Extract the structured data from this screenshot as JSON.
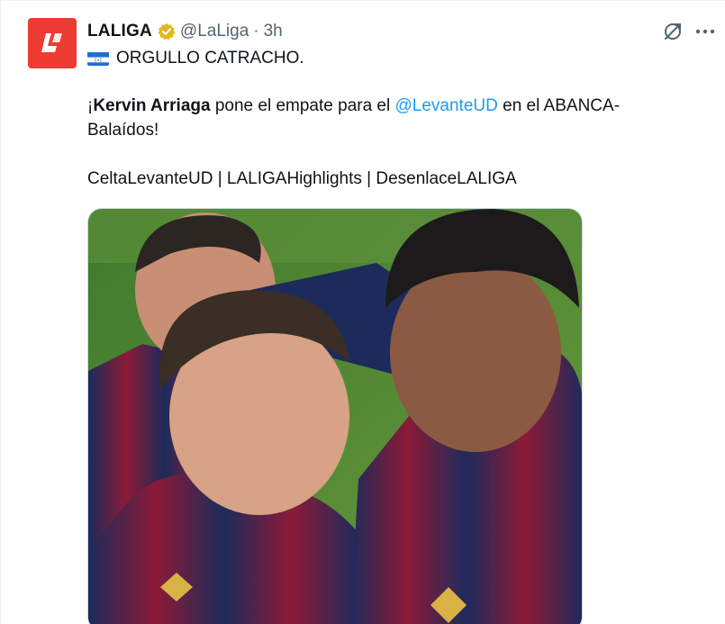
{
  "tweet": {
    "author_name": "LALIGA",
    "handle": "@LaLiga",
    "separator": "·",
    "time": "3h",
    "flag_icon": "honduras-flag-icon",
    "line1": "ORGULLO CATRACHO.",
    "line2_start": "¡",
    "line2_bold": "Kervin Arriaga",
    "line2_mid": " pone el empate para el ",
    "line2_mention": "@LevanteUD",
    "line2_end": " en el ABANCA-",
    "line3": "Balaídos!",
    "hashtags": "CeltaLevanteUD | LALIGAHighlights | DesenlaceLALIGA",
    "media_alt": "Levante players celebrating"
  },
  "colors": {
    "brand_red": "#ee3b33",
    "verified_gold": "#e2b719",
    "mention_blue": "#1d9bf0",
    "secondary_text": "#536471"
  },
  "icons": [
    "laliga-logo-icon",
    "verified-badge-icon",
    "grok-icon",
    "more-icon"
  ]
}
